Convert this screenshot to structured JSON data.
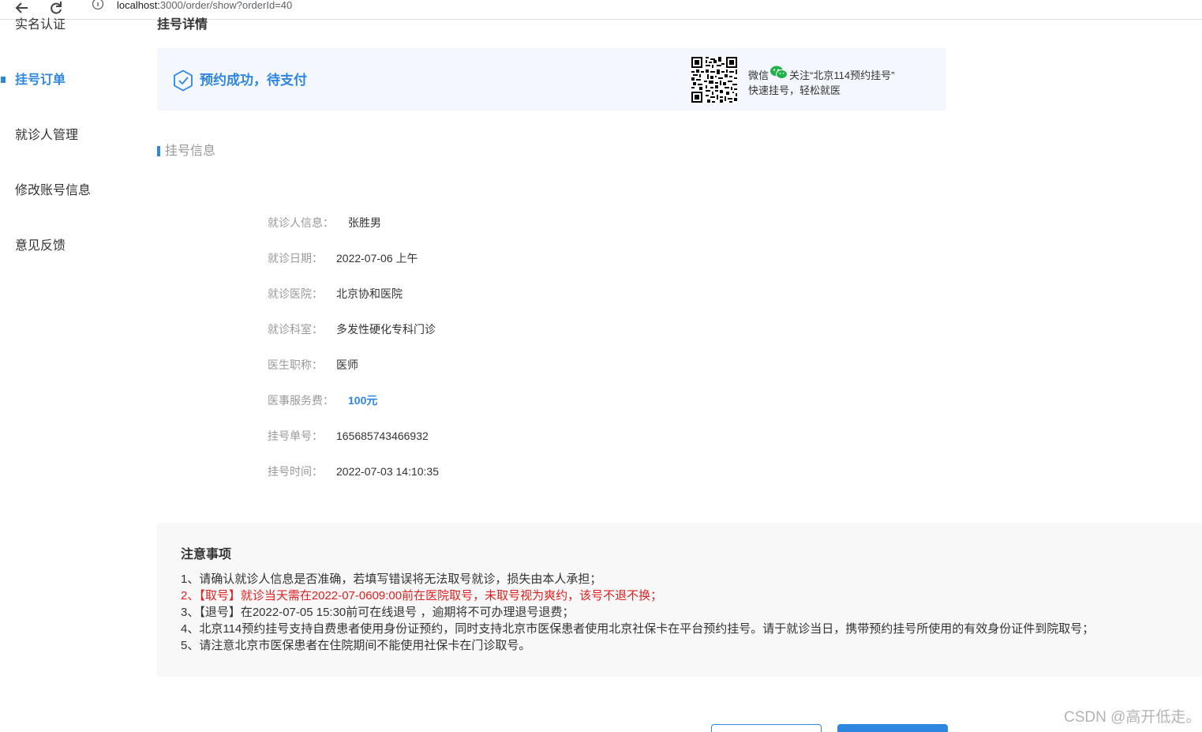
{
  "browser": {
    "url_host": "localhost:",
    "url_path": "3000/order/show?orderId=40"
  },
  "sidebar": {
    "items": [
      {
        "label": "实名认证"
      },
      {
        "label": "挂号订单",
        "active": true
      },
      {
        "label": "就诊人管理"
      },
      {
        "label": "修改账号信息"
      },
      {
        "label": "意见反馈"
      }
    ]
  },
  "page": {
    "title": "挂号详情"
  },
  "status": {
    "text": "预约成功，待支付",
    "wechat_prefix": "微信",
    "wechat_follow": "关注“北京114预约挂号”",
    "wechat_sub": "快速挂号，轻松就医"
  },
  "section": {
    "title": "挂号信息"
  },
  "info": {
    "patient": {
      "label": "就诊人信息：",
      "value": "张胜男"
    },
    "date": {
      "label": "就诊日期：",
      "value": "2022-07-06 上午"
    },
    "hospital": {
      "label": "就诊医院：",
      "value": "北京协和医院"
    },
    "department": {
      "label": "就诊科室：",
      "value": "多发性硬化专科门诊"
    },
    "doctor_title": {
      "label": "医生职称：",
      "value": "医师"
    },
    "fee": {
      "label": "医事服务费：",
      "value": "100元"
    },
    "order_no": {
      "label": "挂号单号：",
      "value": "165685743466932"
    },
    "order_time": {
      "label": "挂号时间：",
      "value": "2022-07-03 14:10:35"
    }
  },
  "notice": {
    "title": "注意事项",
    "lines": [
      "1、请确认就诊人信息是否准确，若填写错误将无法取号就诊，损失由本人承担；",
      "2、【取号】就诊当天需在2022-07-0609:00前在医院取号，未取号视为爽约，该号不退不换；",
      "3、【退号】在2022-07-05 15:30前可在线退号 ，逾期将不可办理退号退费；",
      "4、北京114预约挂号支持自费患者使用身份证预约，同时支持北京市医保患者使用北京社保卡在平台预约挂号。请于就诊当日，携带预约挂号所使用的有效身份证件到院取号；",
      "5、请注意北京市医保患者在住院期间不能使用社保卡在门诊取号。"
    ]
  },
  "watermark": "CSDN @高开低走。",
  "colors": {
    "accent": "#2f86e1",
    "warning": "#e02020",
    "label_gray": "#999999",
    "banner_bg": "#f4f8fe",
    "notice_bg": "#f8f8f8"
  }
}
